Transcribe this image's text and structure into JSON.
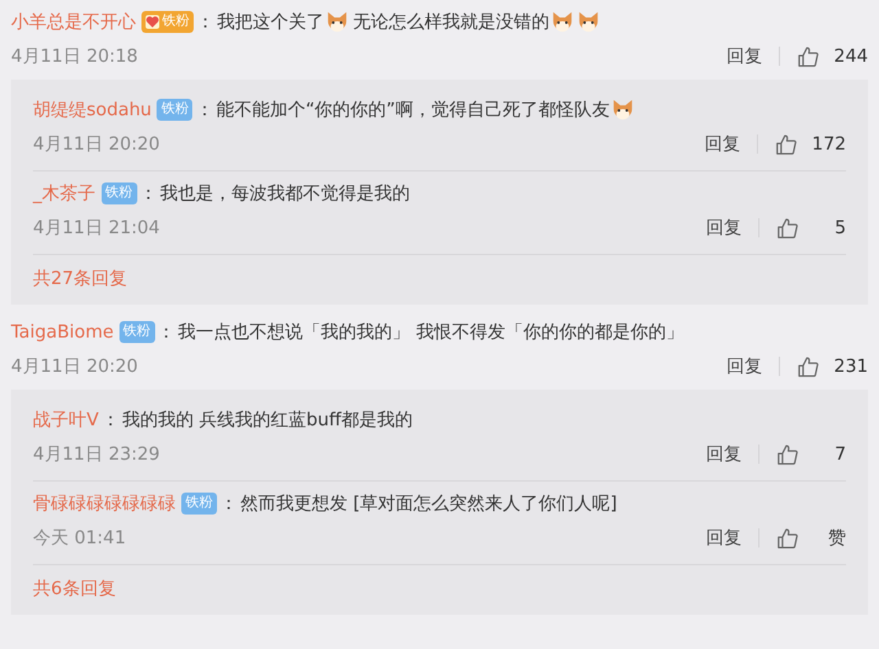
{
  "threads": [
    {
      "user": "小羊总是不开心",
      "colon": "：",
      "badge": {
        "label": "铁粉",
        "kind": "gold"
      },
      "content": [
        {
          "kind": "text",
          "text": "我把这个关了"
        },
        {
          "kind": "emoji"
        },
        {
          "kind": "text",
          "text": "无论怎么样我就是没错的"
        },
        {
          "kind": "emoji"
        },
        {
          "kind": "emoji"
        }
      ],
      "time": "4月11日 20:18",
      "reply_label": "回复",
      "likes": "244",
      "replies": [
        {
          "user": "胡缇缇sodahu",
          "colon": "：",
          "badge": {
            "label": "铁粉",
            "kind": "blue"
          },
          "content": [
            {
              "kind": "text",
              "text": "能不能加个“你的你的”啊，觉得自己死了都怪队友"
            },
            {
              "kind": "emoji"
            }
          ],
          "time": "4月11日 20:20",
          "reply_label": "回复",
          "likes": "172"
        },
        {
          "user": "_木茶子",
          "colon": "：",
          "badge": {
            "label": "铁粉",
            "kind": "blue"
          },
          "content": [
            {
              "kind": "text",
              "text": "我也是，每波我都不觉得是我的"
            }
          ],
          "time": "4月11日 21:04",
          "reply_label": "回复",
          "likes": "5"
        }
      ],
      "more": "共27条回复"
    },
    {
      "user": "TaigaBiome",
      "colon": "：",
      "badge": {
        "label": "铁粉",
        "kind": "blue"
      },
      "content": [
        {
          "kind": "text",
          "text": "我一点也不想说「我的我的」 我恨不得发「你的你的都是你的」"
        }
      ],
      "time": "4月11日 20:20",
      "reply_label": "回复",
      "likes": "231",
      "replies": [
        {
          "user": "战子叶V",
          "colon": "：",
          "content": [
            {
              "kind": "text",
              "text": "我的我的 兵线我的红蓝buff都是我的"
            }
          ],
          "time": "4月11日 23:29",
          "reply_label": "回复",
          "likes": "7"
        },
        {
          "user": "骨碌碌碌碌碌碌碌",
          "colon": "：",
          "badge": {
            "label": "铁粉",
            "kind": "blue"
          },
          "content": [
            {
              "kind": "text",
              "text": "然而我更想发 [草对面怎么突然来人了你们人呢]"
            }
          ],
          "time": "今天 01:41",
          "reply_label": "回复",
          "likes": "赞"
        }
      ],
      "more": "共6条回复"
    }
  ]
}
